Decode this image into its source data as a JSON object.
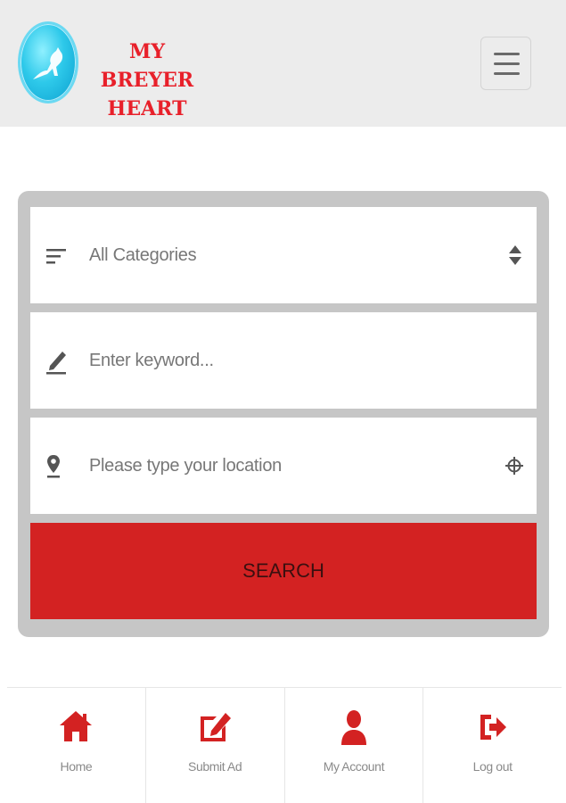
{
  "header": {
    "brand_line1": "MY BREYER",
    "brand_line2": "HEART",
    "logo_icon": "horse-logo-icon",
    "menu_icon": "hamburger-menu-icon"
  },
  "search": {
    "category_label": "All Categories",
    "keyword_placeholder": "Enter keyword...",
    "location_placeholder": "Please type your location",
    "button_label": "SEARCH",
    "icons": {
      "category": "filter-lines-icon",
      "category_trail": "sort-updown-icon",
      "keyword": "pencil-icon",
      "location": "map-pin-icon",
      "location_trail": "crosshair-icon"
    }
  },
  "bottom_nav": {
    "items": [
      {
        "label": "Home",
        "icon": "home-icon"
      },
      {
        "label": "Submit Ad",
        "icon": "edit-icon"
      },
      {
        "label": "My Account",
        "icon": "user-icon"
      },
      {
        "label": "Log out",
        "icon": "logout-icon"
      }
    ]
  },
  "colors": {
    "accent": "#d32222",
    "brand_text": "#e8202a",
    "header_bg": "#ececec",
    "panel_bg": "#c6c6c6"
  }
}
